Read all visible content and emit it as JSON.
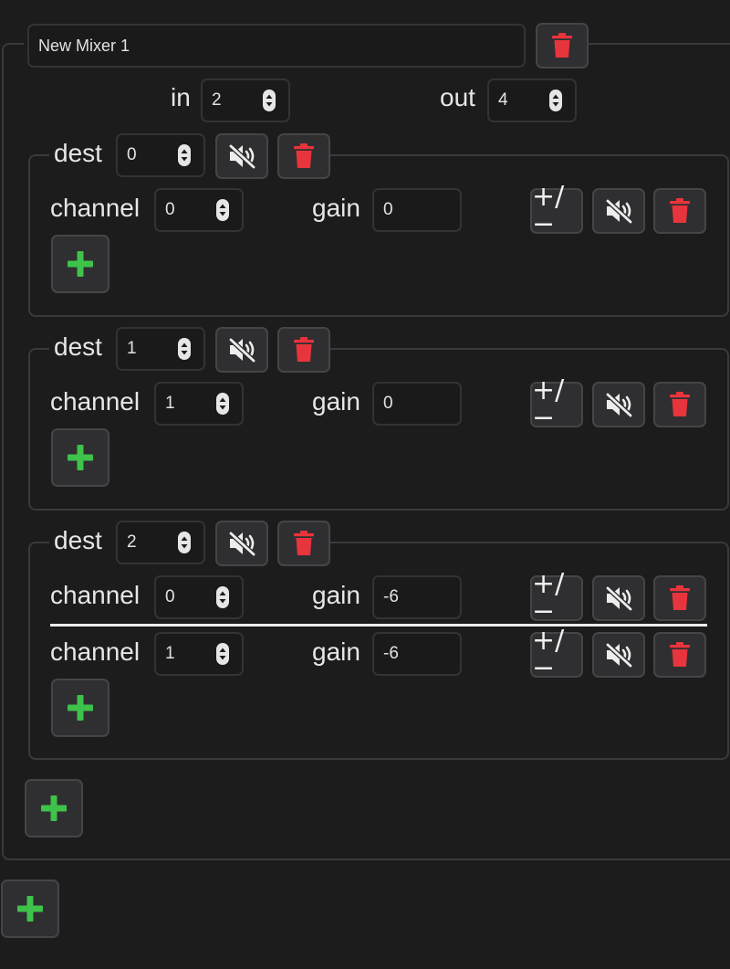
{
  "mixer": {
    "name": "New Mixer 1",
    "in_label": "in",
    "in_value": "2",
    "out_label": "out",
    "out_value": "4"
  },
  "labels": {
    "dest": "dest",
    "channel": "channel",
    "gain": "gain",
    "sign_toggle": "+/−"
  },
  "dests": [
    {
      "dest": "0",
      "channels": [
        {
          "channel": "0",
          "gain": "0"
        }
      ]
    },
    {
      "dest": "1",
      "channels": [
        {
          "channel": "1",
          "gain": "0"
        }
      ]
    },
    {
      "dest": "2",
      "channels": [
        {
          "channel": "0",
          "gain": "-6"
        },
        {
          "channel": "1",
          "gain": "-6"
        }
      ]
    }
  ],
  "icons": {
    "delete": "trash-icon",
    "mute": "speaker-muted-icon",
    "add": "plus-icon",
    "stepper": "spinner-arrows-icon"
  },
  "colors": {
    "background": "#1c1c1d",
    "delete_red": "#e8343c",
    "add_green": "#3ec24a",
    "border": "#3a3a3c",
    "text": "#e6e6e6"
  }
}
